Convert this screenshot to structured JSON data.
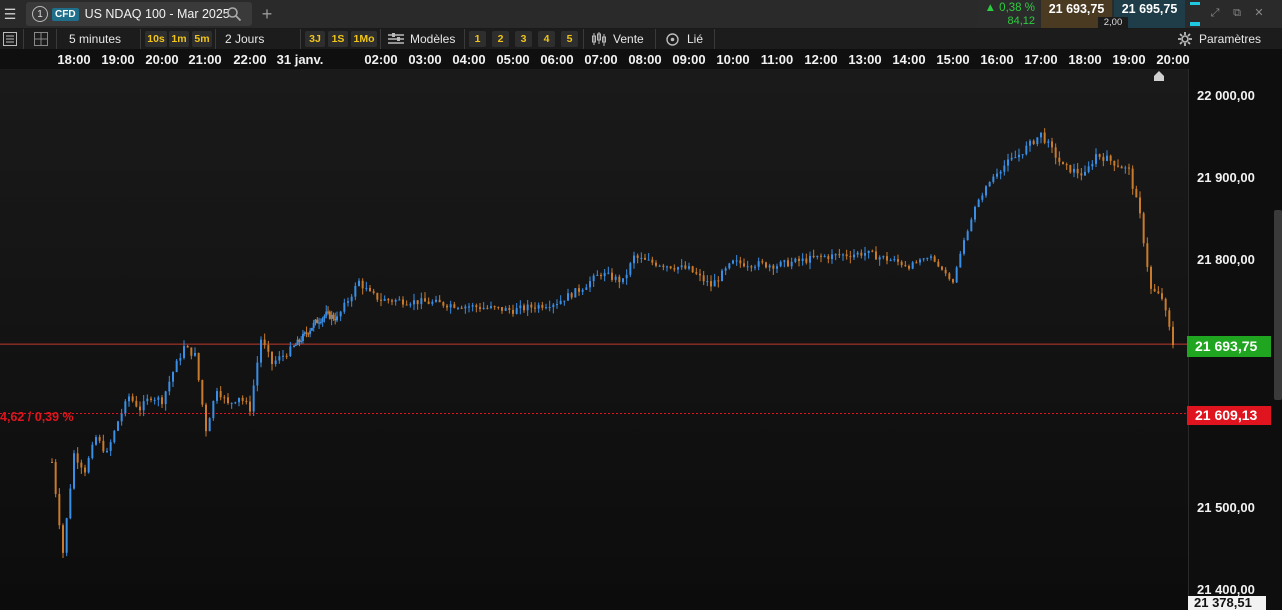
{
  "titlebar": {
    "tab_number": "1",
    "instrument_badge": "CFD",
    "instrument_name": "US NDAQ 100 - Mar 2025",
    "change_pct": "▲ 0,38 %",
    "change_pts": "84,12",
    "sell_price": "21 693,75",
    "buy_price": "21 695,75",
    "spread": "2,00"
  },
  "toolbar": {
    "interval": "5 minutes",
    "interval_buttons": [
      "10s",
      "1m",
      "5m"
    ],
    "range": "2 Jours",
    "range_buttons": [
      "3J",
      "1S",
      "1Mo"
    ],
    "templates_label": "Modèles",
    "template_buttons": [
      "1",
      "2",
      "3",
      "4",
      "5"
    ],
    "sell_label": "Vente",
    "linked_label": "Lié",
    "settings_label": "Paramètres"
  },
  "timeaxis": {
    "ticks": [
      "18:00",
      "19:00",
      "20:00",
      "21:00",
      "22:00",
      "31 janv.",
      "02:00",
      "03:00",
      "04:00",
      "05:00",
      "06:00",
      "07:00",
      "08:00",
      "09:00",
      "10:00",
      "11:00",
      "12:00",
      "13:00",
      "14:00",
      "15:00",
      "16:00",
      "17:00",
      "18:00",
      "19:00",
      "20:00"
    ]
  },
  "chart": {
    "current_price_label": "21 693,75",
    "reference_price_label": "21 609,13",
    "reference_change_text": "4,62 / 0,39 %",
    "low_price_label": "21 378,51",
    "price_axis_labels": [
      "22 000,00",
      "21 900,00",
      "21 800,00",
      "21 500,00",
      "21 400,00"
    ],
    "colors": {
      "up": "#3a8ee6",
      "down": "#c87b2c",
      "current_line": "#c0392b",
      "reference_line": "#e0141e",
      "current_badge": "#1fa51f"
    }
  },
  "chart_data": {
    "type": "candlestick",
    "instrument": "US NDAQ 100 - Mar 2025",
    "interval": "5 minutes",
    "range": "2 Jours",
    "ylim": [
      21378.51,
      22030
    ],
    "y_ticks": [
      22000,
      21900,
      21800,
      21500,
      21400
    ],
    "current_price": 21693.75,
    "reference_price": 21609.13,
    "x_ticks": [
      "18:00",
      "19:00",
      "20:00",
      "21:00",
      "22:00",
      "31 janv.",
      "02:00",
      "03:00",
      "04:00",
      "05:00",
      "06:00",
      "07:00",
      "08:00",
      "09:00",
      "10:00",
      "11:00",
      "12:00",
      "13:00",
      "14:00",
      "15:00",
      "16:00",
      "17:00",
      "18:00",
      "19:00",
      "20:00"
    ],
    "close_path": [
      [
        "17:30",
        21550
      ],
      [
        "17:45",
        21440
      ],
      [
        "18:00",
        21560
      ],
      [
        "18:15",
        21540
      ],
      [
        "18:30",
        21580
      ],
      [
        "18:45",
        21560
      ],
      [
        "19:00",
        21600
      ],
      [
        "19:15",
        21630
      ],
      [
        "19:30",
        21615
      ],
      [
        "19:45",
        21630
      ],
      [
        "20:00",
        21625
      ],
      [
        "20:15",
        21660
      ],
      [
        "20:30",
        21690
      ],
      [
        "20:45",
        21680
      ],
      [
        "21:00",
        21590
      ],
      [
        "21:15",
        21640
      ],
      [
        "21:30",
        21620
      ],
      [
        "21:45",
        21630
      ],
      [
        "22:00",
        21615
      ],
      [
        "22:15",
        21700
      ],
      [
        "22:30",
        21670
      ],
      [
        "23:00",
        21690
      ],
      [
        "23:30",
        21705
      ],
      [
        "00:00",
        21720
      ],
      [
        "00:30",
        21730
      ],
      [
        "01:00",
        21725
      ],
      [
        "01:30",
        21770
      ],
      [
        "01:45",
        21755
      ],
      [
        "02:00",
        21748
      ],
      [
        "03:00",
        21745
      ],
      [
        "04:00",
        21740
      ],
      [
        "05:00",
        21735
      ],
      [
        "06:00",
        21745
      ],
      [
        "06:30",
        21760
      ],
      [
        "07:00",
        21780
      ],
      [
        "07:30",
        21770
      ],
      [
        "07:45",
        21800
      ],
      [
        "08:00",
        21795
      ],
      [
        "09:00",
        21785
      ],
      [
        "09:30",
        21765
      ],
      [
        "10:00",
        21793
      ],
      [
        "11:00",
        21790
      ],
      [
        "12:00",
        21800
      ],
      [
        "13:00",
        21805
      ],
      [
        "14:00",
        21790
      ],
      [
        "14:30",
        21800
      ],
      [
        "15:00",
        21770
      ],
      [
        "15:15",
        21820
      ],
      [
        "15:30",
        21860
      ],
      [
        "15:45",
        21885
      ],
      [
        "16:00",
        21905
      ],
      [
        "16:30",
        21925
      ],
      [
        "17:00",
        21950
      ],
      [
        "17:15",
        21930
      ],
      [
        "17:30",
        21910
      ],
      [
        "18:00",
        21900
      ],
      [
        "18:15",
        21925
      ],
      [
        "18:30",
        21920
      ],
      [
        "19:00",
        21905
      ],
      [
        "19:15",
        21850
      ],
      [
        "19:30",
        21760
      ],
      [
        "19:45",
        21750
      ],
      [
        "20:00",
        21693.75
      ]
    ]
  }
}
